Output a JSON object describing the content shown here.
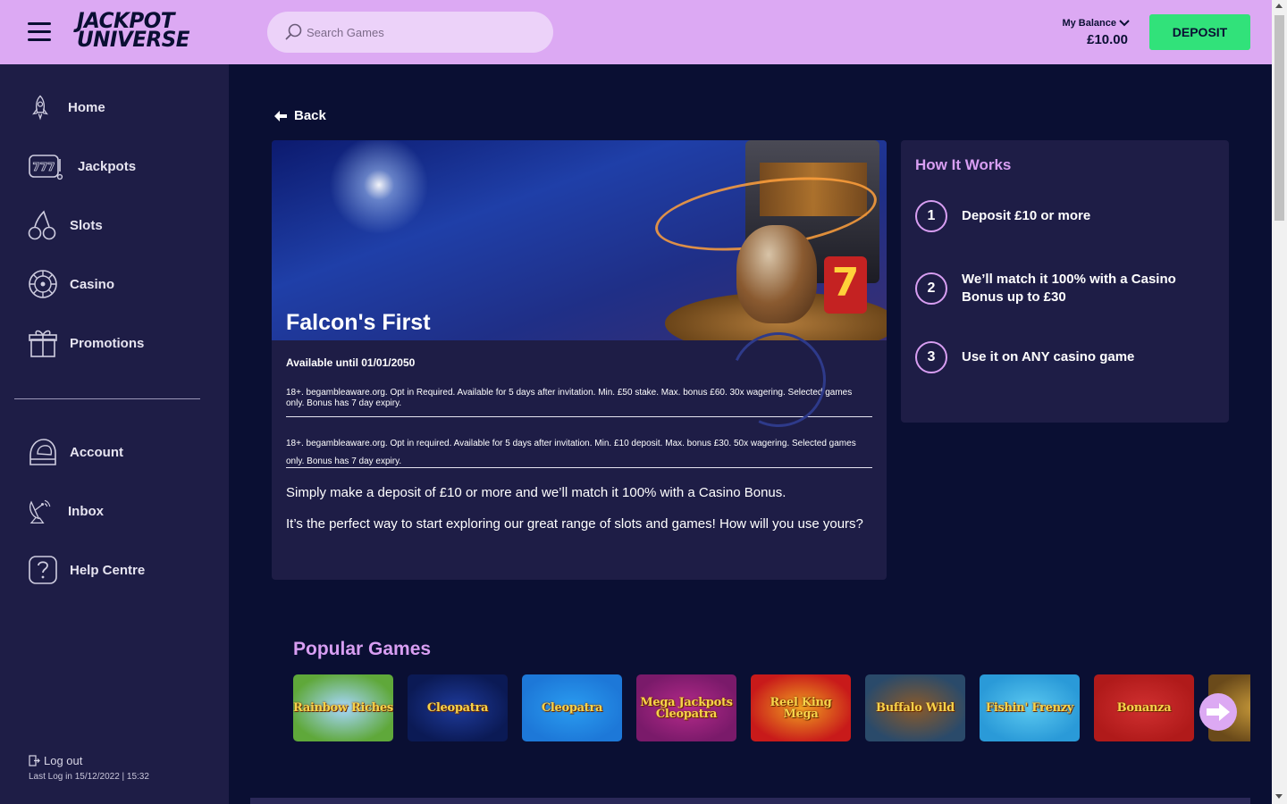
{
  "header": {
    "logo_line1": "JACKPOT",
    "logo_line2": "UNIVERSE",
    "search_placeholder": "Search Games",
    "balance_label": "My Balance",
    "balance_value": "£10.00",
    "deposit_label": "DEPOSIT"
  },
  "sidebar": {
    "items": [
      {
        "label": "Home",
        "icon": "rocket-icon"
      },
      {
        "label": "Jackpots",
        "icon": "slot-machine-icon"
      },
      {
        "label": "Slots",
        "icon": "cherries-icon"
      },
      {
        "label": "Casino",
        "icon": "roulette-icon"
      },
      {
        "label": "Promotions",
        "icon": "gift-icon"
      },
      {
        "label": "Account",
        "icon": "astronaut-helmet-icon"
      },
      {
        "label": "Inbox",
        "icon": "satellite-dish-icon"
      },
      {
        "label": "Help Centre",
        "icon": "question-icon"
      }
    ],
    "logout_label": "Log out",
    "last_log": "Last Log in 15/12/2022 | 15:32"
  },
  "main": {
    "back_label": "Back",
    "promo": {
      "title": "Falcon's First",
      "available": "Available until 01/01/2050",
      "terms1": "18+. begambleaware.org. Opt in Required. Available for 5 days after invitation. Min. £50 stake. Max. bonus £60. 30x wagering. Selected games only. Bonus has 7 day expiry.",
      "terms2": "18+. begambleaware.org. Opt in required. Available for 5 days after invitation. Min. £10 deposit. Max. bonus £30. 50x wagering. Selected games only. Bonus has 7 day expiry.",
      "desc1": "Simply make a deposit of £10 or more and we’ll match it 100% with a Casino Bonus.",
      "desc2": "It’s the perfect way to start exploring our great range of slots and games! How will you use yours?"
    },
    "how_it_works": {
      "title": "How It Works",
      "steps": [
        {
          "num": "1",
          "text": "Deposit £10 or more"
        },
        {
          "num": "2",
          "text": "We’ll match it 100% with a Casino Bonus up to £30"
        },
        {
          "num": "3",
          "text": "Use it on ANY casino game"
        }
      ]
    },
    "popular_games": {
      "title": "Popular Games",
      "games": [
        {
          "name": "Rainbow Riches",
          "bg": "#5fa83a",
          "accent": "#a7d7ff"
        },
        {
          "name": "Cleopatra",
          "bg": "#0b1a55",
          "accent": "#1e3a9a"
        },
        {
          "name": "Cleopatra",
          "bg": "#1d78d8",
          "accent": "#2a9cf0"
        },
        {
          "name": "Mega Jackpots Cleopatra",
          "bg": "#7a1a6a",
          "accent": "#b42a8a"
        },
        {
          "name": "Reel King Mega",
          "bg": "#c81a1a",
          "accent": "#f0a020"
        },
        {
          "name": "Buffalo Wild",
          "bg": "#2a4a6a",
          "accent": "#8a5a2a"
        },
        {
          "name": "Fishin' Frenzy",
          "bg": "#2a9ad8",
          "accent": "#5ac8f0"
        },
        {
          "name": "Bonanza",
          "bg": "#b01a1a",
          "accent": "#d03030"
        },
        {
          "name": "",
          "bg": "#6a4a1a",
          "accent": "#c89a3a"
        }
      ]
    }
  }
}
